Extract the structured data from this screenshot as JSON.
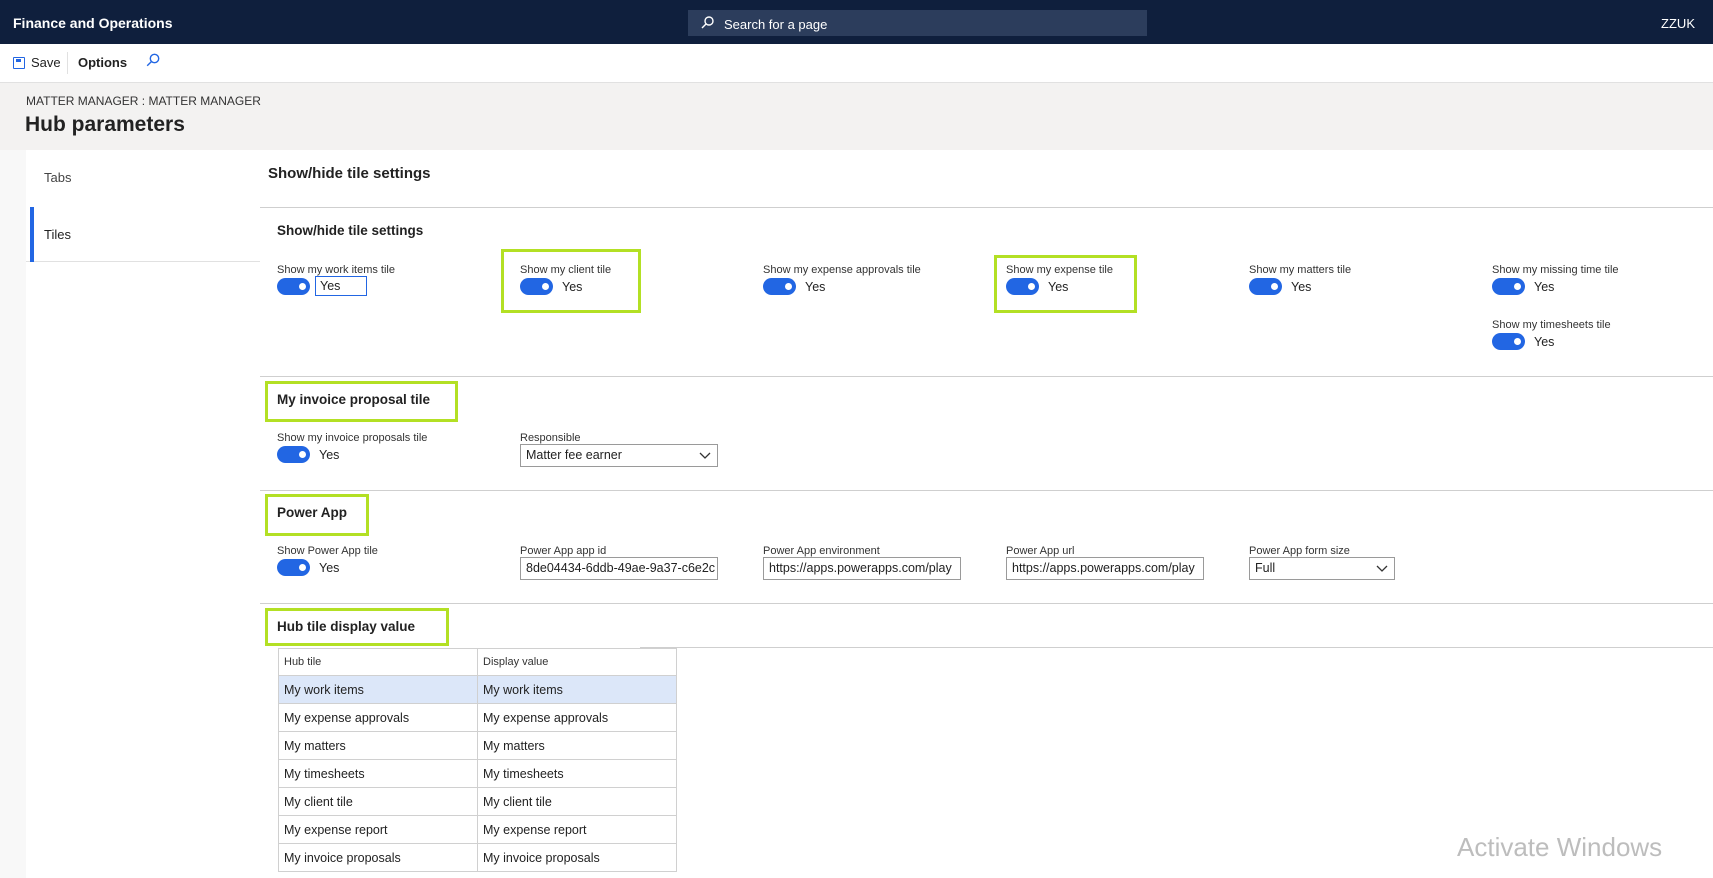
{
  "app": {
    "title": "Finance and Operations",
    "search_placeholder": "Search for a page",
    "user": "ZZUK"
  },
  "toolbar": {
    "save_label": "Save",
    "options_label": "Options"
  },
  "header": {
    "breadcrumb": "MATTER MANAGER : MATTER MANAGER",
    "title": "Hub parameters"
  },
  "nav": {
    "items": [
      {
        "label": "Tabs"
      },
      {
        "label": "Tiles"
      }
    ],
    "selected": "Tiles"
  },
  "main": {
    "title": "Show/hide tile settings",
    "section_showhide": {
      "title": "Show/hide tile settings",
      "fields": [
        {
          "label": "Show my work items tile",
          "value": "Yes"
        },
        {
          "label": "Show my client tile",
          "value": "Yes"
        },
        {
          "label": "Show my expense approvals tile",
          "value": "Yes"
        },
        {
          "label": "Show my expense tile",
          "value": "Yes"
        },
        {
          "label": "Show my matters tile",
          "value": "Yes"
        },
        {
          "label": "Show my missing time tile",
          "value": "Yes"
        },
        {
          "label": "Show my timesheets tile",
          "value": "Yes"
        }
      ]
    },
    "section_invoice": {
      "title": "My invoice proposal tile",
      "toggle_label": "Show my invoice proposals tile",
      "toggle_value": "Yes",
      "responsible_label": "Responsible",
      "responsible_value": "Matter fee earner"
    },
    "section_powerapp": {
      "title": "Power App",
      "toggle_label": "Show Power App tile",
      "toggle_value": "Yes",
      "app_id_label": "Power App app id",
      "app_id_value": "8de04434-6ddb-49ae-9a37-c6e2c",
      "env_label": "Power App environment",
      "env_value": "https://apps.powerapps.com/play",
      "url_label": "Power App url",
      "url_value": "https://apps.powerapps.com/play",
      "form_size_label": "Power App form size",
      "form_size_value": "Full"
    },
    "section_display": {
      "title": "Hub tile display value",
      "columns": [
        "Hub tile",
        "Display value"
      ],
      "rows": [
        [
          "My work items",
          "My work items"
        ],
        [
          "My expense approvals",
          "My expense approvals"
        ],
        [
          "My matters",
          "My matters"
        ],
        [
          "My timesheets",
          "My timesheets"
        ],
        [
          "My client tile",
          "My client tile"
        ],
        [
          "My expense report",
          "My expense report"
        ],
        [
          "My invoice proposals",
          "My invoice proposals"
        ]
      ]
    }
  },
  "watermark": "Activate Windows",
  "colors": {
    "topbar": "#0f1f3d",
    "accent": "#2266e3",
    "highlight": "#b3e024"
  }
}
